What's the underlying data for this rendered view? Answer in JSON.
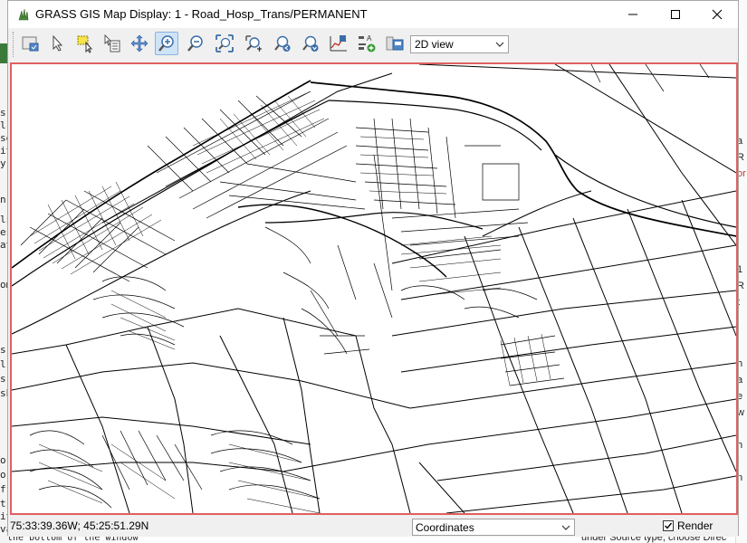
{
  "window": {
    "title": "GRASS GIS Map Display: 1 - Road_Hosp_Trans/PERMANENT",
    "controls": {
      "minimize": "minimize-icon",
      "maximize": "maximize-icon",
      "close": "close-icon"
    }
  },
  "toolbar": {
    "tools": [
      {
        "name": "display-map-icon"
      },
      {
        "name": "pointer-icon"
      },
      {
        "name": "select-icon"
      },
      {
        "name": "query-icon"
      },
      {
        "name": "pan-icon"
      },
      {
        "name": "zoom-in-icon",
        "active": true
      },
      {
        "name": "zoom-out-icon"
      },
      {
        "name": "zoom-extent-icon"
      },
      {
        "name": "zoom-region-icon"
      },
      {
        "name": "zoom-back-icon"
      },
      {
        "name": "zoom-menu-icon"
      },
      {
        "name": "analyze-icon"
      },
      {
        "name": "overlay-icon"
      },
      {
        "name": "save-image-icon"
      }
    ],
    "view_mode": "2D view"
  },
  "statusbar": {
    "coordinates": "75:33:39.36W; 45:25:51.29N",
    "mode": "Coordinates",
    "render_label": "Render",
    "render_checked": true
  },
  "colors": {
    "canvas_border": "#e06060",
    "road": "#000000"
  },
  "background": {
    "left_fragments": [
      "s",
      "l",
      "se",
      "it",
      "y",
      "n",
      "ls",
      "es",
      "at",
      "om",
      "s",
      "l",
      "s",
      "sh",
      "o",
      "o",
      "f",
      "t",
      "it",
      "va"
    ],
    "right_fragments": [
      "a",
      "R",
      "or",
      "1",
      "R",
      "t",
      "h",
      "a",
      "e",
      "w",
      "l",
      "h",
      "I",
      "n"
    ],
    "bottom_left_text": "the bottom of the window",
    "bottom_right_text": "under Source type, choose Direc"
  }
}
